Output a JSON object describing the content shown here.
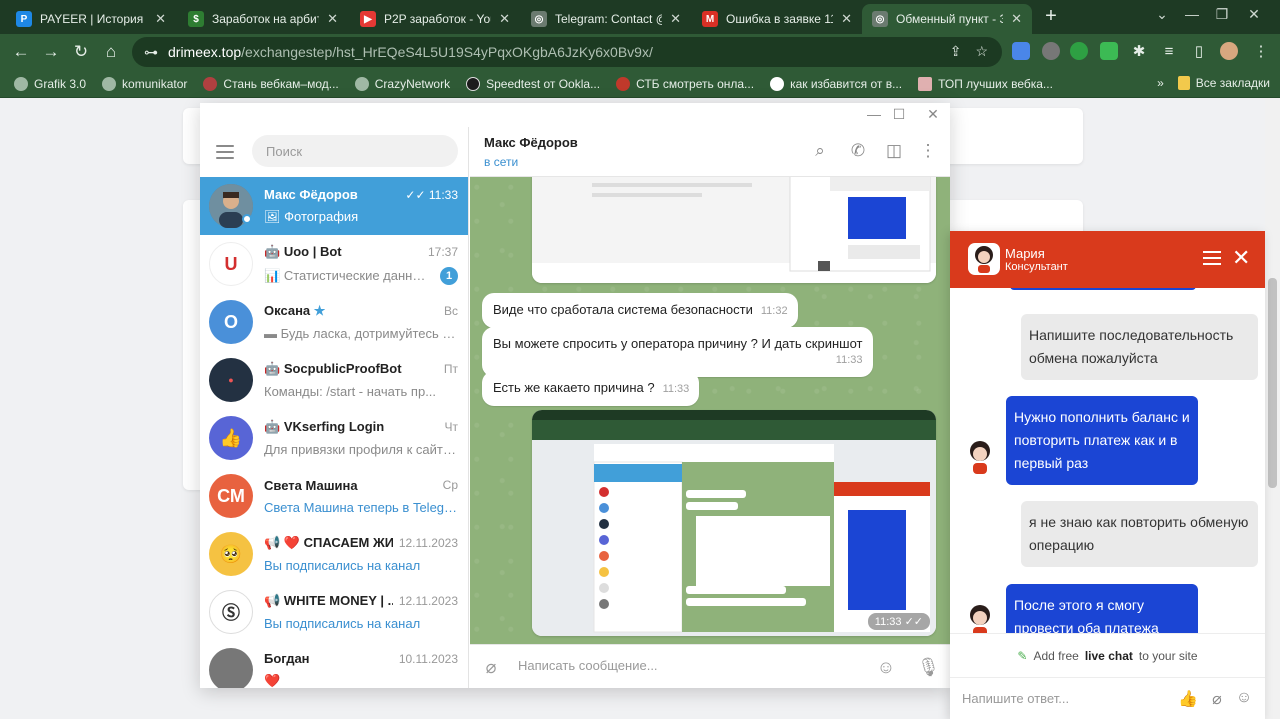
{
  "browser": {
    "tabs": [
      {
        "title": "PAYEER | История",
        "favicon": "P",
        "favicon_color": "#1e88e5"
      },
      {
        "title": "Заработок на арбитр",
        "favicon": "$",
        "favicon_color": "#2e7d32"
      },
      {
        "title": "P2P заработок - You",
        "favicon": "▶",
        "favicon_color": "#e53935"
      },
      {
        "title": "Telegram: Contact @",
        "favicon": "◎",
        "favicon_color": "#6b7b70"
      },
      {
        "title": "Ошибка в заявке 11!",
        "favicon": "M",
        "favicon_color": "#d93025"
      },
      {
        "title": "Обменный пункт - З",
        "favicon": "◎",
        "favicon_color": "#6b7b70"
      }
    ],
    "tab_close": "✕",
    "new_tab": "+",
    "url_host": "drimeex.top",
    "url_path": "/exchangestep/hst_HrEQeS4L5U19S4yPqxOKgbA6JzKy6x0Bv9x/",
    "bookmarks": [
      "Grafik 3.0",
      "komunikator",
      "Стань вебкам–мод...",
      "CrazyNetwork",
      "Speedtest от Ookla...",
      "СТБ смотреть онла...",
      "как избавится от в...",
      "ТОП лучших вебка..."
    ],
    "bookmarks_more": "»",
    "all_bookmarks": "Все закладки"
  },
  "telegram": {
    "search_placeholder": "Поиск",
    "chats": [
      {
        "name": "Макс Фёдоров",
        "time": "11:33",
        "preview": "Фотография",
        "avatar_color": "#5a7a8c",
        "initials": "",
        "active": true,
        "ticks": "✓✓"
      },
      {
        "name": "Uoo | Bot",
        "time": "17:37",
        "preview": "Статистические данные ...",
        "avatar_color": "#ffffff",
        "initials": "U",
        "unread": "1"
      },
      {
        "name": "Оксана",
        "time": "Вс",
        "preview": "Будь ласка, дотримуйтесь пі...",
        "avatar_color": "#4a90d9",
        "initials": "О"
      },
      {
        "name": "SocpublicProofBot",
        "time": "Пт",
        "preview": "Команды:      /start - начать пр...",
        "avatar_color": "#233142",
        "initials": ""
      },
      {
        "name": "VKserfing Login",
        "time": "Чт",
        "preview": "Для привязки профиля к сайту ...",
        "avatar_color": "#5865d6",
        "initials": "👍"
      },
      {
        "name": "Света Машина",
        "time": "Ср",
        "preview": "Света Машина теперь в Telegram",
        "avatar_color": "#e8623f",
        "initials": "СМ",
        "link": true
      },
      {
        "name": "❤️ СПАСАЕМ ЖИ...",
        "time": "12.11.2023",
        "preview": "Вы подписались на канал",
        "avatar_color": "#f5c242",
        "initials": "🥺",
        "link": true
      },
      {
        "name": "WHITE MONEY | ...",
        "time": "12.11.2023",
        "preview": "Вы подписались на канал",
        "avatar_color": "#ffffff",
        "initials": "Ⓢ",
        "link": true
      },
      {
        "name": "Богдан",
        "time": "10.11.2023",
        "preview": "❤️",
        "avatar_color": "#777777",
        "initials": ""
      }
    ],
    "contact": {
      "name": "Макс Фёдоров",
      "status": "в сети"
    },
    "messages": [
      {
        "text": "Виде что сработала система безопасности",
        "time": "11:32"
      },
      {
        "text": "Вы можете спросить у оператора причину ? И дать скриншот",
        "time": "11:33"
      },
      {
        "text": "Есть же какаето причина ?",
        "time": "11:33"
      }
    ],
    "photo_time": "11:33",
    "input_placeholder": "Написать сообщение..."
  },
  "support": {
    "operator_name": "Мария",
    "operator_role": "Консультант",
    "messages": [
      {
        "from": "op",
        "text": "Напишите последовательность обмена пожалуйста"
      },
      {
        "from": "me",
        "text": "Нужно пополнить баланс и повторить платеж как и в первый раз"
      },
      {
        "from": "op",
        "text": "я не знаю как повторить обменую операцию"
      },
      {
        "from": "me",
        "text": "После этого я смогу провести оба платежа"
      }
    ],
    "powered_pre": "Add free",
    "powered_bold": "live chat",
    "powered_post": "to your site",
    "input_placeholder": "Напишите ответ...",
    "header_color": "#d93a1c",
    "bubble_color": "#1b45d4"
  }
}
